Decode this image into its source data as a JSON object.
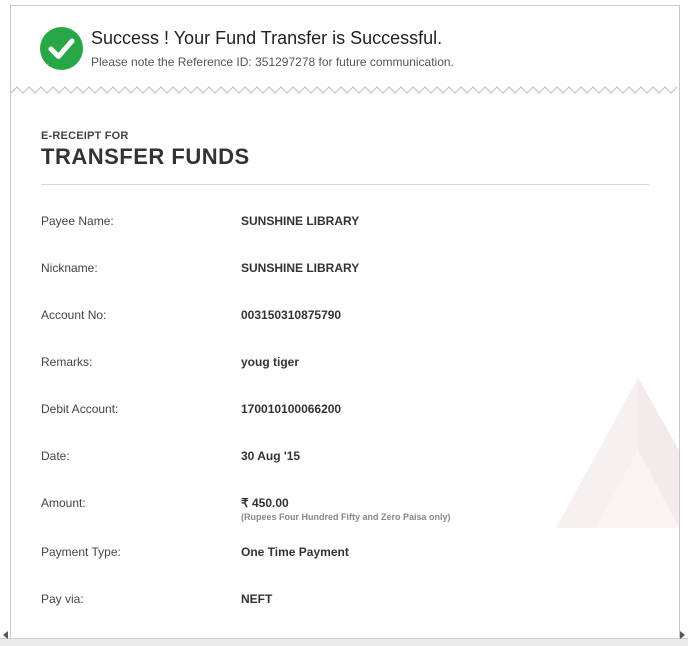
{
  "banner": {
    "title": "Success ! Your Fund Transfer is Successful.",
    "subtitle": "Please note the Reference ID: 351297278 for future communication.",
    "icon": "checkmark-circle-icon",
    "accent_color": "#27a745"
  },
  "receipt": {
    "label": "E-RECEIPT FOR",
    "title": "TRANSFER FUNDS",
    "fields": [
      {
        "label": "Payee Name:",
        "value": "SUNSHINE LIBRARY"
      },
      {
        "label": "Nickname:",
        "value": "SUNSHINE LIBRARY"
      },
      {
        "label": "Account No:",
        "value": "003150310875790"
      },
      {
        "label": "Remarks:",
        "value": "youg tiger"
      },
      {
        "label": "Debit Account:",
        "value": "170010100066200"
      },
      {
        "label": "Date:",
        "value": "30 Aug '15"
      },
      {
        "label": "Amount:",
        "value": "₹ 450.00",
        "note": "(Rupees Four Hundred Fifty and Zero Paisa only)"
      },
      {
        "label": "Payment Type:",
        "value": "One Time Payment"
      },
      {
        "label": "Pay via:",
        "value": "NEFT"
      }
    ]
  }
}
